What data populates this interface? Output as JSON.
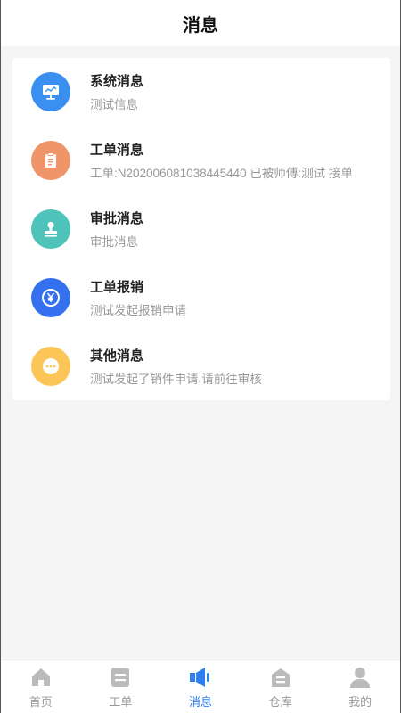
{
  "header": {
    "title": "消息"
  },
  "messages": [
    {
      "title": "系统消息",
      "subtitle": "测试信息",
      "icon": "monitor-icon",
      "color": "#3a8ff0"
    },
    {
      "title": "工单消息",
      "subtitle": "工单:N202006081038445440 已被师傅:测试 接单",
      "icon": "clipboard-icon",
      "color": "#f0956a"
    },
    {
      "title": "审批消息",
      "subtitle": "审批消息",
      "icon": "stamp-icon",
      "color": "#4ec3b9"
    },
    {
      "title": "工单报销",
      "subtitle": "测试发起报销申请",
      "icon": "yen-coin-icon",
      "color": "#3570ee"
    },
    {
      "title": "其他消息",
      "subtitle": "测试发起了销件申请,请前往审核",
      "icon": "chat-dots-icon",
      "color": "#fbc558"
    }
  ],
  "tabbar": {
    "active": "消息",
    "active_color": "#2f7ff0",
    "inactive_color": "#bbbbbb",
    "tabs": [
      {
        "label": "首页",
        "icon": "home-icon"
      },
      {
        "label": "工单",
        "icon": "order-icon"
      },
      {
        "label": "消息",
        "icon": "megaphone-icon"
      },
      {
        "label": "仓库",
        "icon": "warehouse-icon"
      },
      {
        "label": "我的",
        "icon": "user-icon"
      }
    ]
  }
}
